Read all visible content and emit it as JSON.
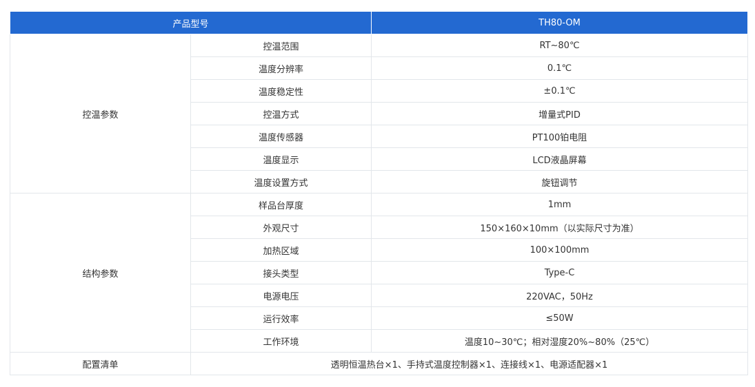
{
  "header": {
    "model_label": "产品型号",
    "model_value": "TH80-OM"
  },
  "groups": [
    {
      "name": "控温参数",
      "rows": [
        {
          "label": "控温范围",
          "value": "RT~80℃"
        },
        {
          "label": "温度分辨率",
          "value": "0.1℃"
        },
        {
          "label": "温度稳定性",
          "value": "±0.1℃"
        },
        {
          "label": "控温方式",
          "value": "增量式PID"
        },
        {
          "label": "温度传感器",
          "value": "PT100铂电阻"
        },
        {
          "label": "温度显示",
          "value": "LCD液晶屏幕"
        },
        {
          "label": "温度设置方式",
          "value": "旋钮调节"
        }
      ]
    },
    {
      "name": "结构参数",
      "rows": [
        {
          "label": "样品台厚度",
          "value": "1mm"
        },
        {
          "label": "外观尺寸",
          "value": "150×160×10mm（以实际尺寸为准）"
        },
        {
          "label": "加热区域",
          "value": "100×100mm"
        },
        {
          "label": "接头类型",
          "value": "Type-C"
        },
        {
          "label": "电源电压",
          "value": "220VAC，50Hz"
        },
        {
          "label": "运行效率",
          "value": "≤50W"
        },
        {
          "label": "工作环境",
          "value": "温度10~30℃；相对湿度20%~80%（25℃）"
        }
      ]
    }
  ],
  "config": {
    "label": "配置清单",
    "value": "透明恒温热台×1、手持式温度控制器×1、连接线×1、电源适配器×1"
  }
}
